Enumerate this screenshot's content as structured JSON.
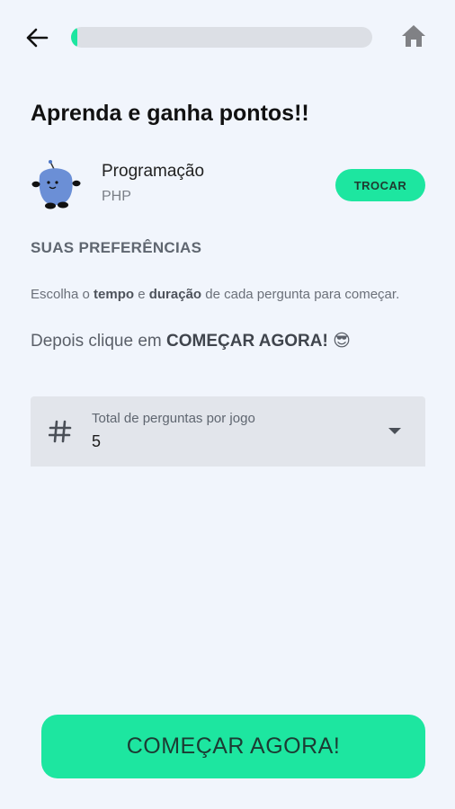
{
  "header": {
    "back_icon": "arrow-left-icon",
    "home_icon": "home-icon",
    "progress_percent": 2,
    "progress_color": "#1de6a0"
  },
  "page": {
    "title": "Aprenda e ganha pontos!!"
  },
  "topic": {
    "name": "Programação",
    "subtopic": "PHP",
    "change_label": "TROCAR",
    "mascot_icon": "blue-blob-mascot-icon"
  },
  "preferences": {
    "heading": "SUAS PREFERÊNCIAS",
    "desc_part1": "Escolha o ",
    "desc_bold1": "tempo",
    "desc_part2": " e ",
    "desc_bold2": "duração",
    "desc_part3": " de cada pergunta para começar.",
    "desc2_part1": "Depois clique em ",
    "desc2_bold": "COMEÇAR AGORA!",
    "desc2_emoji": "😎"
  },
  "questions_select": {
    "icon": "hash-icon",
    "label": "Total de perguntas por jogo",
    "value": "5"
  },
  "cta": {
    "label": "COMEÇAR AGORA!"
  },
  "colors": {
    "accent": "#1de6a0",
    "background": "#f1f5fc"
  }
}
